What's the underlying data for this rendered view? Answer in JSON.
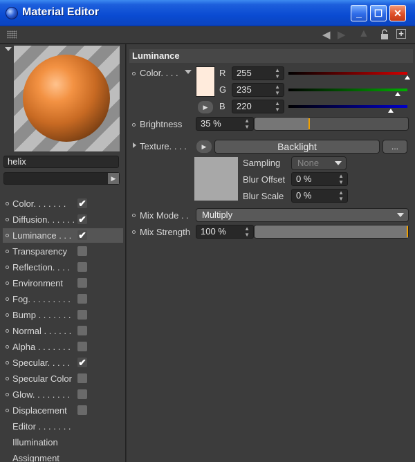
{
  "window": {
    "title": "Material Editor"
  },
  "material": {
    "name": "helix"
  },
  "channels": [
    {
      "label": "Color. . . . . . .",
      "checked": true,
      "has_checkbox": true
    },
    {
      "label": "Diffusion. . . . . .",
      "checked": true,
      "has_checkbox": true
    },
    {
      "label": "Luminance . . .",
      "checked": true,
      "has_checkbox": true,
      "active": true
    },
    {
      "label": "Transparency",
      "checked": false,
      "has_checkbox": true
    },
    {
      "label": "Reflection. . . .",
      "checked": false,
      "has_checkbox": true
    },
    {
      "label": "Environment",
      "checked": false,
      "has_checkbox": true
    },
    {
      "label": "Fog. . . . . . . . .",
      "checked": false,
      "has_checkbox": true
    },
    {
      "label": "Bump . . . . . . .",
      "checked": false,
      "has_checkbox": true
    },
    {
      "label": "Normal . . . . . .",
      "checked": false,
      "has_checkbox": true
    },
    {
      "label": "Alpha . . . . . . .",
      "checked": false,
      "has_checkbox": true
    },
    {
      "label": "Specular. . . . .",
      "checked": true,
      "has_checkbox": true
    },
    {
      "label": "Specular Color",
      "checked": false,
      "has_checkbox": true
    },
    {
      "label": "Glow. . . . . . . .",
      "checked": false,
      "has_checkbox": true
    },
    {
      "label": "Displacement",
      "checked": false,
      "has_checkbox": true
    },
    {
      "label": "Editor . . . . . . .",
      "has_checkbox": false
    },
    {
      "label": "Illumination",
      "has_checkbox": false
    },
    {
      "label": "Assignment",
      "has_checkbox": false
    }
  ],
  "luminance": {
    "section_title": "Luminance",
    "color_label": "Color. . . .",
    "r_label": "R",
    "g_label": "G",
    "b_label": "B",
    "r": "255",
    "g": "235",
    "b": "220",
    "r_fraction": 1.0,
    "g_fraction": 0.92,
    "b_fraction": 0.86,
    "swatch_color": "#ffebdc",
    "brightness_label": "Brightness",
    "brightness": "35 %",
    "brightness_fraction": 0.35,
    "texture_label": "Texture. . . .",
    "texture_name": "Backlight",
    "texture_more": "...",
    "sampling_label": "Sampling",
    "sampling_value": "None",
    "blur_offset_label": "Blur Offset",
    "blur_offset": "0 %",
    "blur_scale_label": "Blur Scale",
    "blur_scale": "0 %",
    "mix_mode_label": "Mix Mode . .",
    "mix_mode": "Multiply",
    "mix_strength_label": "Mix Strength",
    "mix_strength": "100 %",
    "mix_strength_fraction": 1.0
  },
  "colors": {
    "title_bar": "#0a4bd2",
    "slider_marker": "#f0a000",
    "channel_red": "#d00000",
    "channel_green": "#00b000",
    "channel_blue": "#0000c8"
  },
  "icons": [
    "app-sphere-icon",
    "minimize-icon",
    "maximize-icon",
    "close-icon",
    "grid-icon",
    "back-arrow-icon",
    "forward-arrow-icon",
    "up-arrow-icon",
    "lock-icon",
    "new-window-icon",
    "checkmark-icon",
    "play-arrow-icon",
    "dropdown-caret-icon"
  ]
}
